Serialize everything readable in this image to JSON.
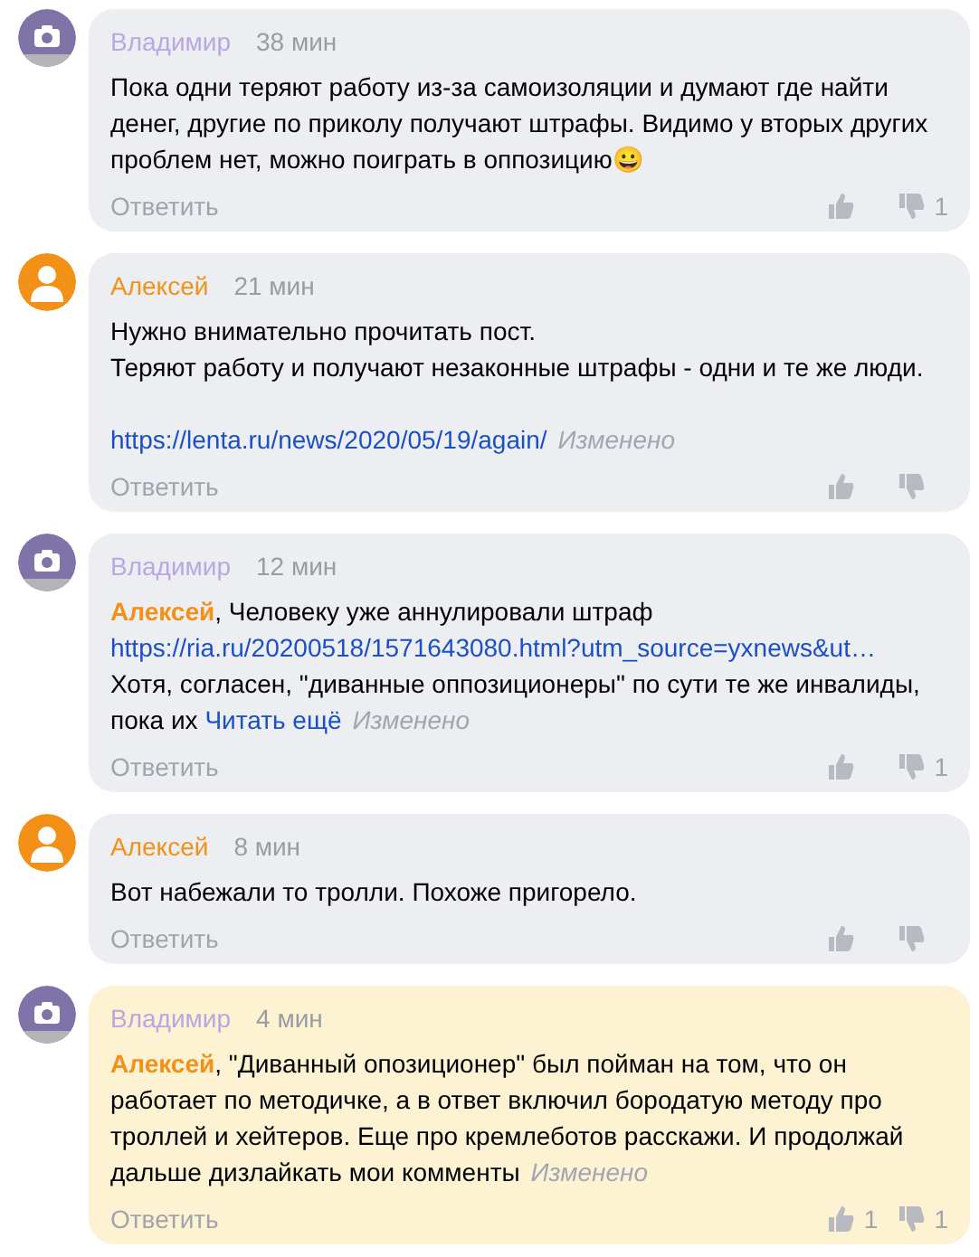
{
  "comments": [
    {
      "author": "Владимир",
      "avatar": {
        "kind": "camera",
        "color": "#7f73a8"
      },
      "time": "38 мин",
      "highlighted": false,
      "body": [
        {
          "spaced": false,
          "parts": [
            {
              "kind": "text",
              "text": "Пока одни теряют работу из-за самоизоляции и думают где найти денег, другие по приколу получают штрафы.  Видимо у вторых других проблем нет, можно поиграть в оппозицию😀"
            }
          ]
        }
      ],
      "reply": "Ответить",
      "dislike_count": "1"
    },
    {
      "author": "Алексей",
      "avatar": {
        "kind": "person",
        "color": "#f39017"
      },
      "time": "21 мин",
      "highlighted": false,
      "body": [
        {
          "spaced": false,
          "parts": [
            {
              "kind": "text",
              "text": "Нужно внимательно прочитать пост."
            }
          ]
        },
        {
          "spaced": false,
          "parts": [
            {
              "kind": "text",
              "text": "Теряют работу и получают незаконные штрафы - одни и те же люди."
            }
          ]
        },
        {
          "spaced": true,
          "parts": [
            {
              "kind": "link",
              "text": "https://lenta.ru/news/2020/05/19/again/"
            },
            {
              "kind": "edited",
              "text": "Изменено"
            }
          ]
        }
      ],
      "reply": "Ответить"
    },
    {
      "author": "Владимир",
      "avatar": {
        "kind": "camera",
        "color": "#7f73a8"
      },
      "time": "12 мин",
      "highlighted": false,
      "body": [
        {
          "spaced": false,
          "parts": [
            {
              "kind": "mention",
              "text": "Алексей"
            },
            {
              "kind": "text",
              "text": ", Человеку уже аннулировали штраф"
            }
          ]
        },
        {
          "spaced": false,
          "parts": [
            {
              "kind": "link",
              "text": "https://ria.ru/20200518/1571643080.html?utm_source=yxnews&ut…"
            }
          ]
        },
        {
          "spaced": false,
          "parts": [
            {
              "kind": "text",
              "text": "Хотя, согласен, \"диванные оппозиционеры\" по сути те же инвалиды, пока их"
            },
            {
              "kind": "link",
              "text": "Читать ещё"
            },
            {
              "kind": "edited",
              "text": "Изменено"
            }
          ]
        }
      ],
      "reply": "Ответить",
      "dislike_count": "1"
    },
    {
      "author": "Алексей",
      "avatar": {
        "kind": "person",
        "color": "#f39017"
      },
      "time": "8 мин",
      "highlighted": false,
      "body": [
        {
          "spaced": false,
          "parts": [
            {
              "kind": "text",
              "text": "Вот набежали то тролли. Похоже пригорело."
            }
          ]
        }
      ],
      "reply": "Ответить"
    },
    {
      "author": "Владимир",
      "avatar": {
        "kind": "camera",
        "color": "#7f73a8"
      },
      "time": "4 мин",
      "highlighted": true,
      "body": [
        {
          "spaced": false,
          "parts": [
            {
              "kind": "mention",
              "text": "Алексей"
            },
            {
              "kind": "text",
              "text": ", \"Диванный опозиционер\" был пойман на том, что он работает по методичке, а в ответ включил бородатую методу про троллей и хейтеров. Еще про кремлеботов расскажи. И продолжай дальше дизлайкать мои комменты"
            },
            {
              "kind": "edited",
              "text": "Изменено"
            }
          ]
        }
      ],
      "reply": "Ответить",
      "like_count": "1",
      "dislike_count": "1"
    }
  ]
}
